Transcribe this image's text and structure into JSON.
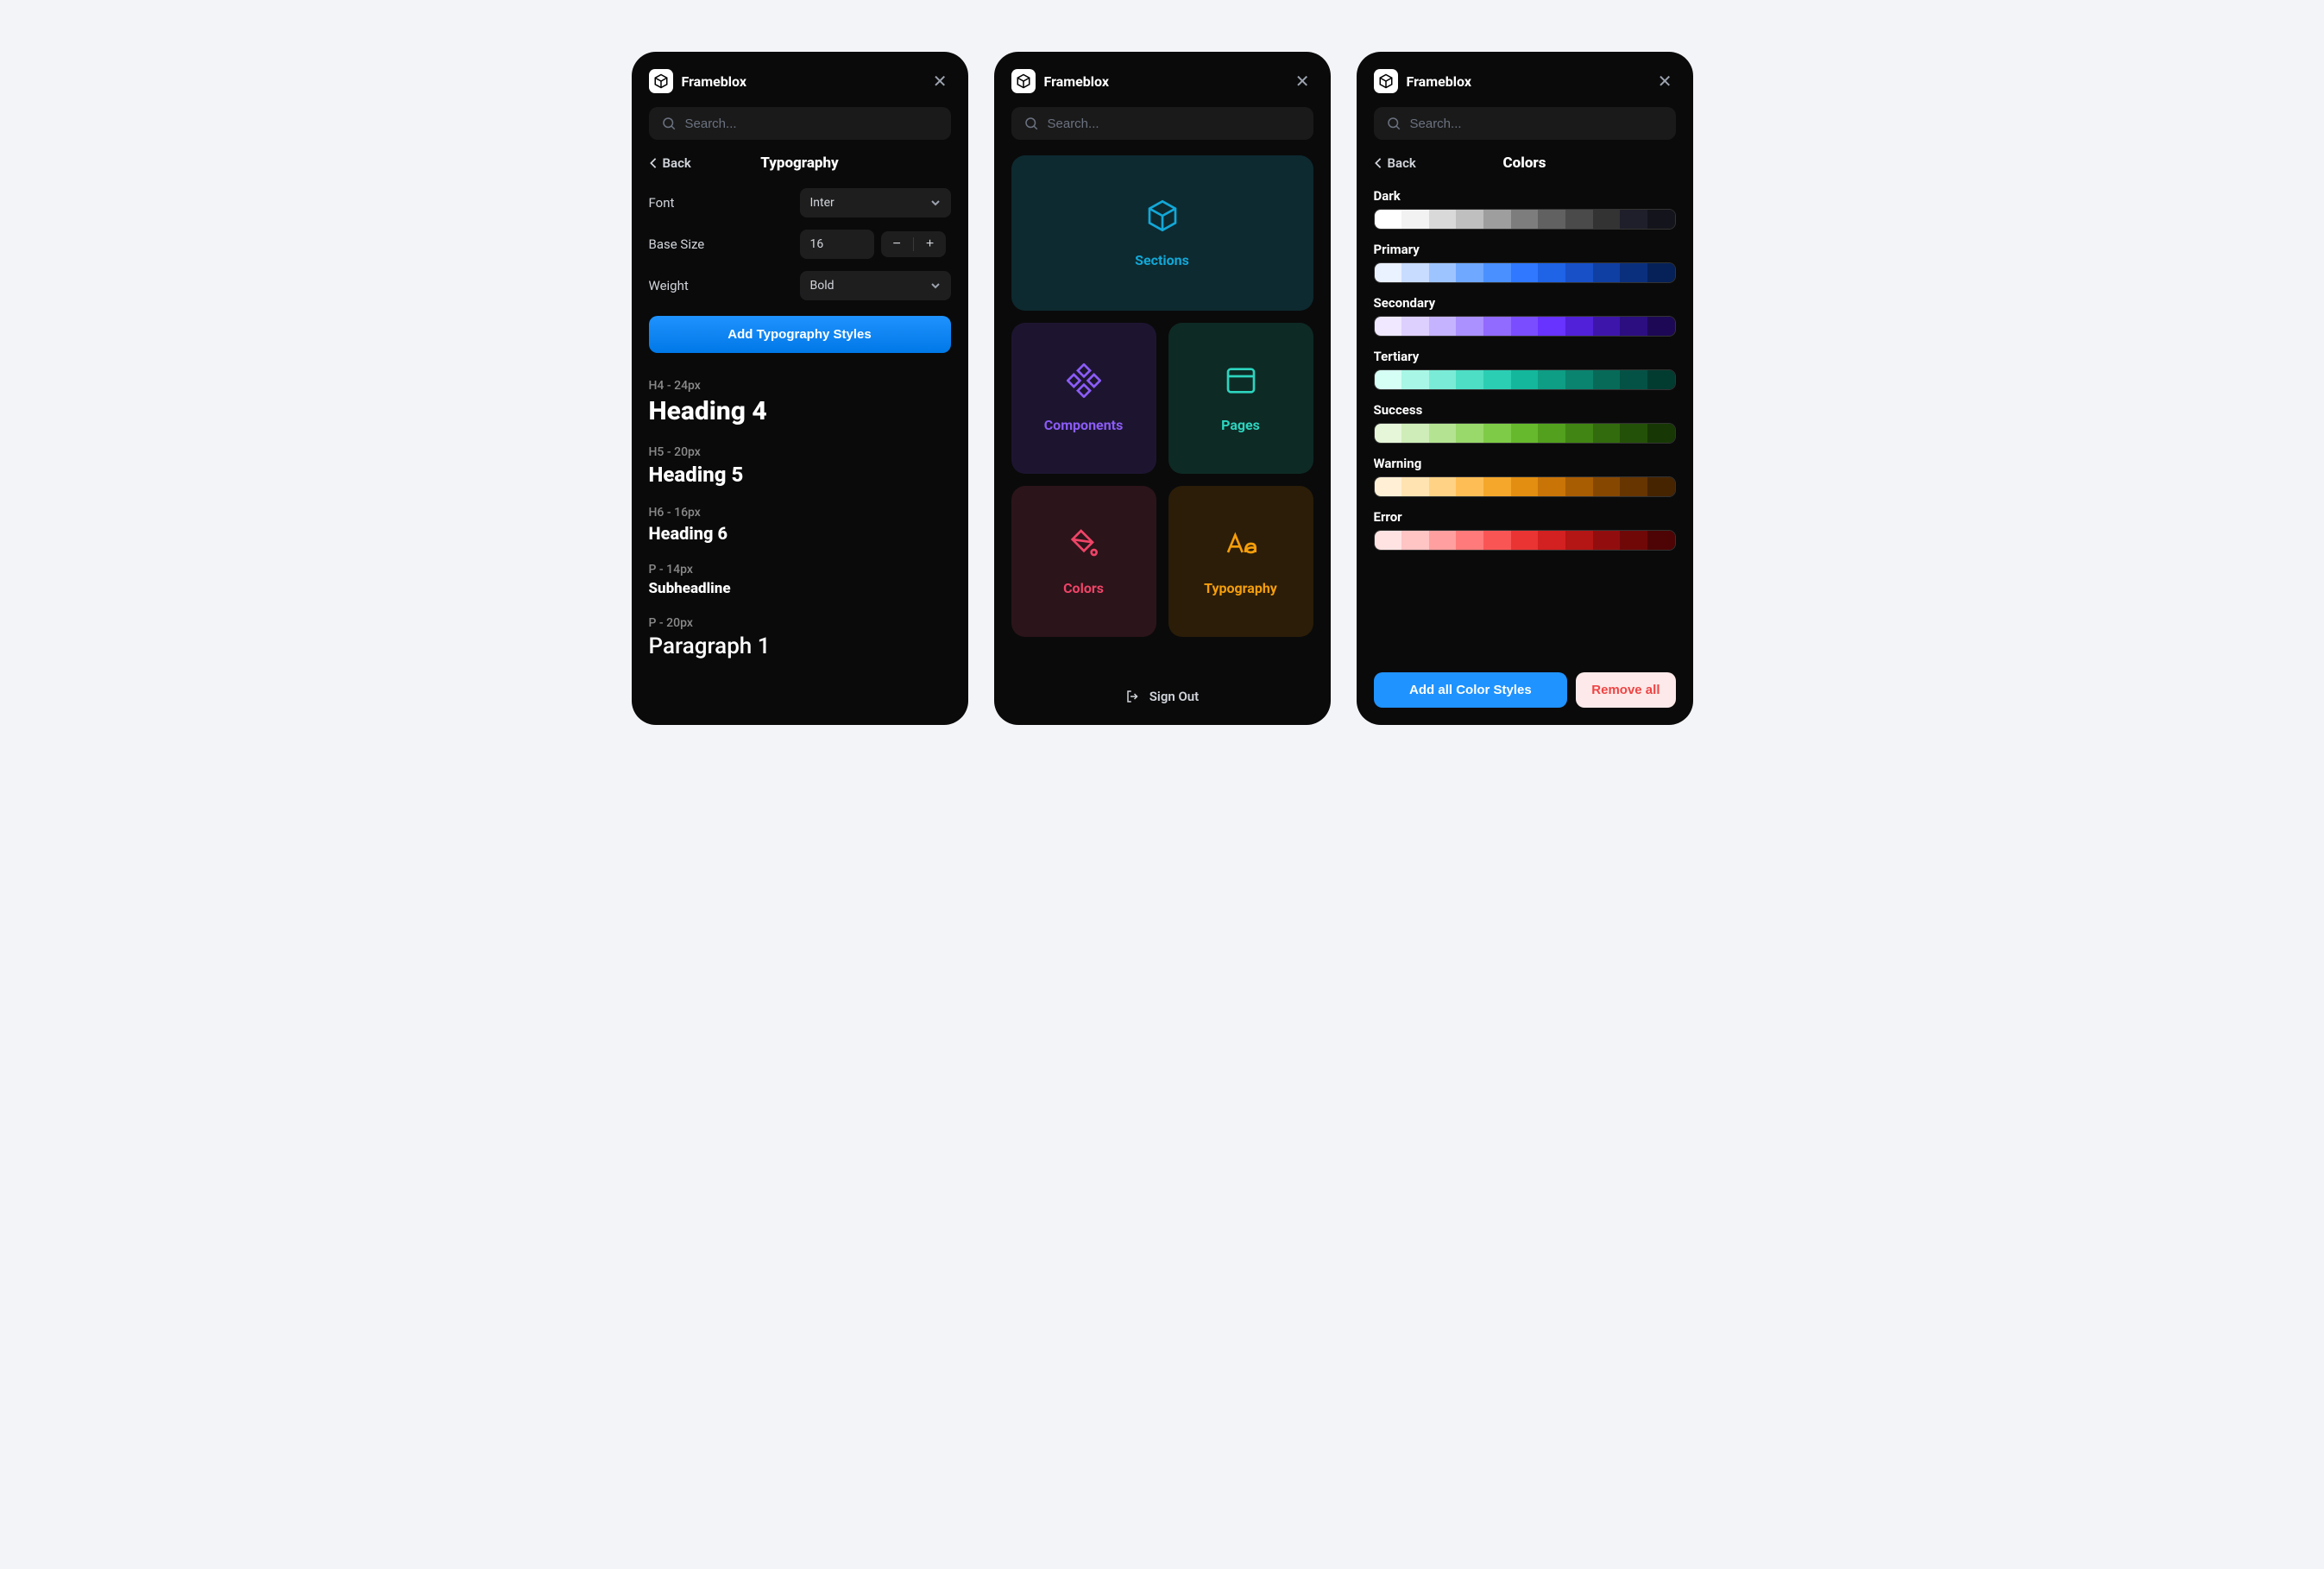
{
  "app_title": "Frameblox",
  "search_placeholder": "Search...",
  "back_label": "Back",
  "typography": {
    "title": "Typography",
    "font_label": "Font",
    "font_value": "Inter",
    "base_size_label": "Base Size",
    "base_size_value": "16",
    "weight_label": "Weight",
    "weight_value": "Bold",
    "add_button": "Add Typography Styles",
    "samples": [
      {
        "meta": "H4 - 24px",
        "text": "Heading 4",
        "cls": "h4"
      },
      {
        "meta": "H5 - 20px",
        "text": "Heading 5",
        "cls": "h5"
      },
      {
        "meta": "H6 - 16px",
        "text": "Heading 6",
        "cls": "h6"
      },
      {
        "meta": "P - 14px",
        "text": "Subheadline",
        "cls": "sub"
      },
      {
        "meta": "P - 20px",
        "text": "Paragraph 1",
        "cls": "p1"
      }
    ]
  },
  "home": {
    "cards": {
      "sections": "Sections",
      "components": "Components",
      "pages": "Pages",
      "colors": "Colors",
      "typography": "Typography"
    },
    "signout": "Sign Out"
  },
  "colors": {
    "title": "Colors",
    "add_button": "Add all Color Styles",
    "remove_button": "Remove all",
    "palettes": [
      {
        "name": "Dark",
        "swatches": [
          "#ffffff",
          "#f2f2f2",
          "#d9d9d9",
          "#bfbfbf",
          "#9e9e9e",
          "#7d7d7d",
          "#616161",
          "#4a4a4a",
          "#333333",
          "#1f1f2b",
          "#14141c"
        ]
      },
      {
        "name": "Primary",
        "swatches": [
          "#eaf1ff",
          "#c7dcff",
          "#9ec4ff",
          "#6fa8ff",
          "#4a90ff",
          "#2f78ff",
          "#1f63e6",
          "#1850c7",
          "#103fa3",
          "#0a2f7d",
          "#052158"
        ]
      },
      {
        "name": "Secondary",
        "swatches": [
          "#efe8ff",
          "#ddd0ff",
          "#c5b3ff",
          "#ab90ff",
          "#916aff",
          "#7a4dff",
          "#6832ff",
          "#5120d9",
          "#3d15ab",
          "#2c0e80",
          "#1d0856"
        ]
      },
      {
        "name": "Tertiary",
        "swatches": [
          "#d5fff4",
          "#a8f6e6",
          "#7aebd6",
          "#4ddec5",
          "#2cceb3",
          "#14b79b",
          "#0e9d85",
          "#0a836f",
          "#076a59",
          "#045245",
          "#023c31"
        ]
      },
      {
        "name": "Success",
        "swatches": [
          "#e6f6d9",
          "#ceedb8",
          "#b4e392",
          "#99d86b",
          "#7ecb47",
          "#66b92d",
          "#52a01e",
          "#418514",
          "#326b0d",
          "#245108",
          "#173804"
        ]
      },
      {
        "name": "Warning",
        "swatches": [
          "#fff0d5",
          "#ffe3b0",
          "#ffd285",
          "#ffbe55",
          "#f5a72b",
          "#e38e10",
          "#c97407",
          "#a85d03",
          "#864801",
          "#663500",
          "#472400"
        ]
      },
      {
        "name": "Error",
        "swatches": [
          "#ffe3e3",
          "#ffc4c4",
          "#ff9f9f",
          "#ff7a7a",
          "#f95555",
          "#ea3434",
          "#d32020",
          "#b41515",
          "#920e0e",
          "#700808",
          "#4e0404"
        ]
      }
    ]
  }
}
